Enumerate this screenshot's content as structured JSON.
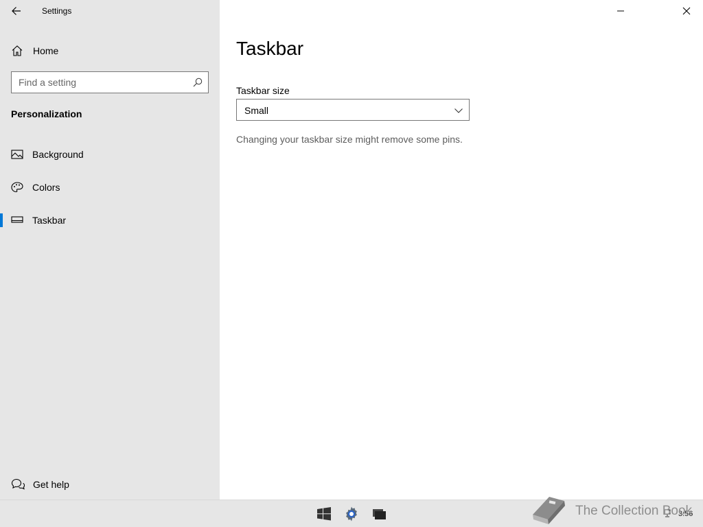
{
  "window": {
    "title": "Settings"
  },
  "sidebar": {
    "home_label": "Home",
    "search_placeholder": "Find a setting",
    "section_title": "Personalization",
    "items": [
      {
        "label": "Background",
        "icon": "picture-icon",
        "selected": false
      },
      {
        "label": "Colors",
        "icon": "palette-icon",
        "selected": false
      },
      {
        "label": "Taskbar",
        "icon": "taskbar-icon",
        "selected": true
      }
    ],
    "help_label": "Get help"
  },
  "main": {
    "title": "Taskbar",
    "field_label": "Taskbar size",
    "dropdown_value": "Small",
    "hint": "Changing your taskbar size might remove some pins."
  },
  "taskbar": {
    "icons": [
      "windows-start-icon",
      "settings-gear-icon",
      "task-view-icon"
    ],
    "watermark_text": "The Collection Book",
    "clock": "3:56"
  },
  "colors": {
    "accent": "#0078d7",
    "sidebar_bg": "#e6e6e6",
    "taskbar_bg": "#e6e6e6"
  }
}
